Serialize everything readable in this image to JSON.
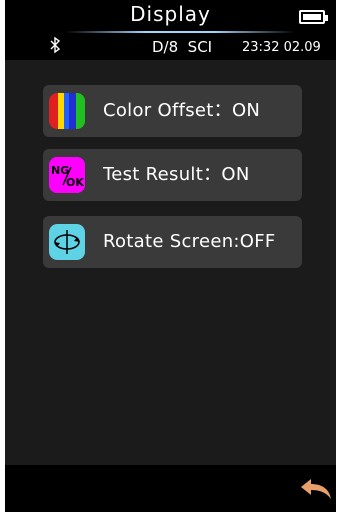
{
  "header": {
    "title": "Display"
  },
  "status": {
    "mode": "D/8  SCI",
    "datetime": "23:32 02.09"
  },
  "menu": [
    {
      "label": "Color Offset：ON",
      "icon": "color-bars-icon"
    },
    {
      "label": "Test Result：ON",
      "icon": "ng-ok-icon",
      "icon_text": "NG/OK"
    },
    {
      "label": "Rotate Screen:OFF",
      "icon": "rotate-icon"
    }
  ],
  "colors": {
    "accent": "#9fd4ff",
    "panel": "#3a3a3a",
    "icon_magenta": "#ff00ff",
    "icon_cyan": "#5fd3e6",
    "back_arrow": "#e8a06a"
  },
  "footer": {
    "back_icon": "back-arrow-icon"
  }
}
